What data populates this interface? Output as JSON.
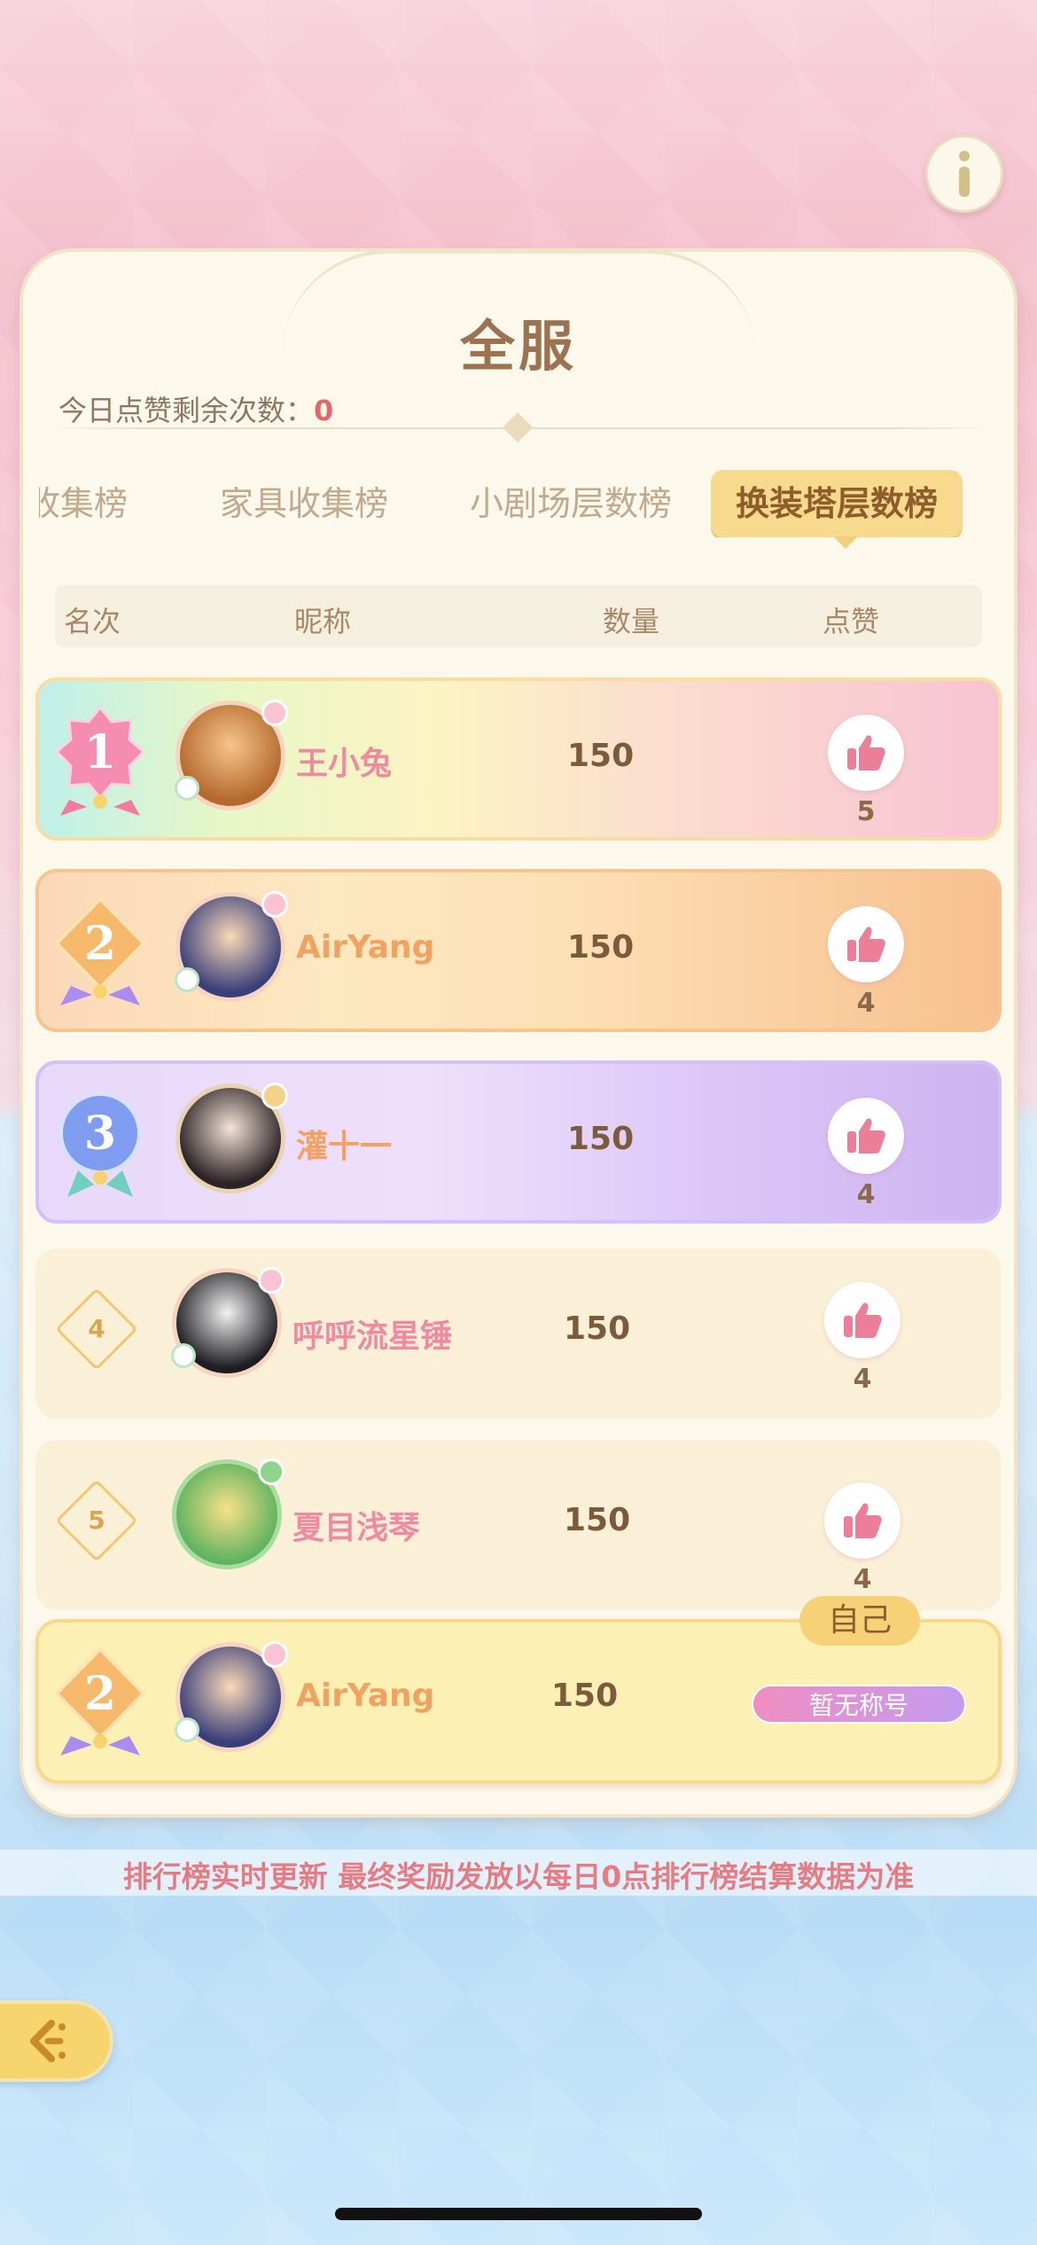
{
  "header": {
    "title": "全服",
    "likes_left_label": "今日点赞剩余次数：",
    "likes_left_count": "0"
  },
  "tabs": [
    {
      "label": "收集榜",
      "active": false
    },
    {
      "label": "家具收集榜",
      "active": false
    },
    {
      "label": "小剧场层数榜",
      "active": false
    },
    {
      "label": "换装塔层数榜",
      "active": true
    }
  ],
  "columns": {
    "rank": "名次",
    "nickname": "昵称",
    "amount": "数量",
    "like": "点赞"
  },
  "rows": [
    {
      "rank": "1",
      "nickname": "王小兔",
      "amount": "150",
      "likes": "5"
    },
    {
      "rank": "2",
      "nickname": "AirYang",
      "amount": "150",
      "likes": "4"
    },
    {
      "rank": "3",
      "nickname": "灌十一",
      "amount": "150",
      "likes": "4"
    },
    {
      "rank": "4",
      "nickname": "呼呼流星锤",
      "amount": "150",
      "likes": "4"
    },
    {
      "rank": "5",
      "nickname": "夏目浅琴",
      "amount": "150",
      "likes": "4"
    }
  ],
  "self_row": {
    "tag": "自己",
    "rank": "2",
    "nickname": "AirYang",
    "amount": "150",
    "title_badge": "暂无称号"
  },
  "footer": {
    "note": "排行榜实时更新 最终奖励发放以每日0点排行榜结算数据为准"
  },
  "icons": {
    "info": "info-icon",
    "like": "thumbs-up-icon",
    "back": "back-arrow-icon"
  },
  "colors": {
    "accent": "#f7da8e",
    "title": "#9b7350",
    "note": "#e67b82"
  }
}
